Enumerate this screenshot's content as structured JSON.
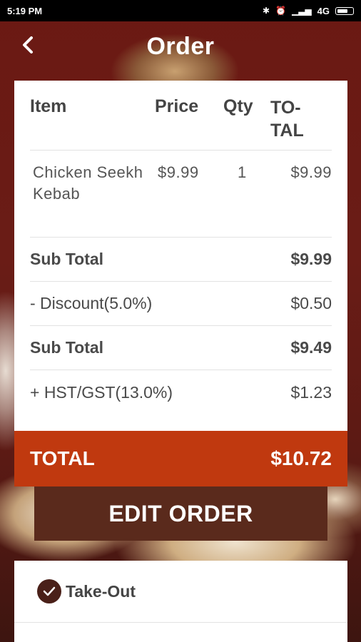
{
  "status_bar": {
    "time": "5:19 PM",
    "network": "4G"
  },
  "header": {
    "title": "Order",
    "back_icon": "chevron-left-icon"
  },
  "order_table": {
    "columns": [
      "Item",
      "Price",
      "Qty",
      "TO-TAL"
    ],
    "items": [
      {
        "name": "Chicken Seekh Kebab",
        "price": "$9.99",
        "qty": "1",
        "total": "$9.99"
      }
    ],
    "summary": [
      {
        "label": "Sub Total",
        "value": "$9.99",
        "bold": true
      },
      {
        "label": "- Discount(5.0%)",
        "value": "$0.50",
        "bold": false
      },
      {
        "label": "Sub Total",
        "value": "$9.49",
        "bold": true
      },
      {
        "label": "+ HST/GST(13.0%)",
        "value": "$1.23",
        "bold": false
      }
    ]
  },
  "total": {
    "label": "TOTAL",
    "value": "$10.72"
  },
  "edit_button": {
    "label": "EDIT ORDER"
  },
  "order_type": {
    "selected": "Take-Out"
  },
  "colors": {
    "accent": "#c0390f",
    "button": "#5a2a1c",
    "check": "#4a2019"
  }
}
